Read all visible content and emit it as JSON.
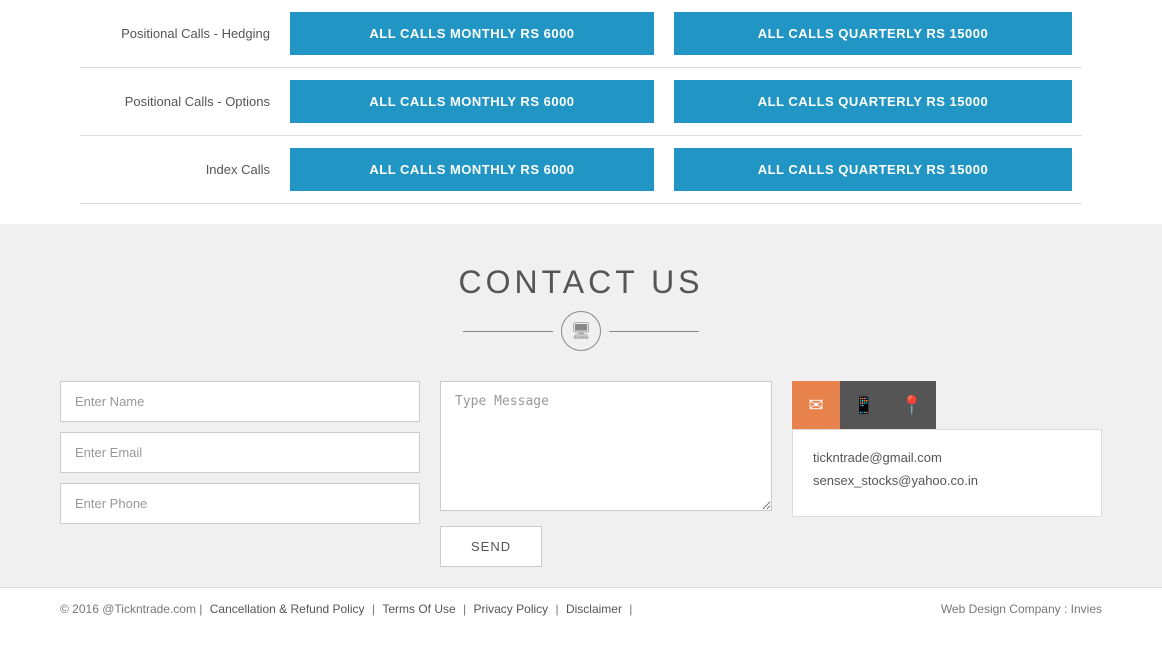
{
  "pricing": {
    "rows": [
      {
        "label": "Positional Calls - Hedging",
        "monthly_btn": "ALL CALLS MONTHLY RS 6000",
        "quarterly_btn": "ALL CALLS QUARTERLY RS 15000"
      },
      {
        "label": "Positional Calls - Options",
        "monthly_btn": "ALL CALLS MONTHLY RS 6000",
        "quarterly_btn": "ALL CALLS QUARTERLY RS 15000"
      },
      {
        "label": "Index Calls",
        "monthly_btn": "ALL CALLS MONTHLY RS 6000",
        "quarterly_btn": "ALL CALLS QUARTERLY RS 15000"
      }
    ]
  },
  "contact": {
    "title": "CONTACT US",
    "name_placeholder": "Enter Name",
    "email_placeholder": "Enter Email",
    "phone_placeholder": "Enter Phone",
    "message_placeholder": "Type Message",
    "send_label": "SEND",
    "email1": "tickntrade@gmail.com",
    "email2": "sensex_stocks@yahoo.co.in",
    "icon_email": "✉",
    "icon_phone": "📱",
    "icon_location": "📍"
  },
  "footer": {
    "copyright": "© 2016 @Tickntrade.com |",
    "links": [
      "Cancellation & Refund Policy",
      "Terms Of Use",
      "Privacy Policy",
      "Disclaimer"
    ],
    "web_design_label": "Web Design Company : Invies"
  }
}
